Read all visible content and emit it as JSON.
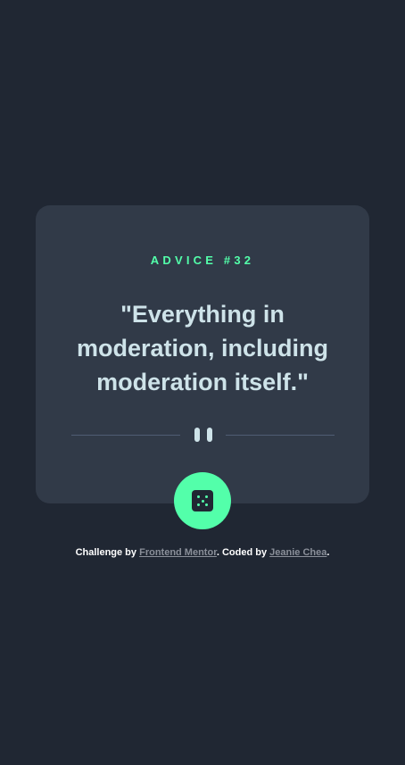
{
  "advice": {
    "label": "ADVICE #32",
    "quote": "\"Everything in moderation, including moderation itself.\""
  },
  "icons": {
    "divider": "pause-icon",
    "dice": "dice-icon"
  },
  "footer": {
    "prefix": "Challenge by ",
    "link1": "Frontend Mentor",
    "middle": ". Coded by ",
    "link2": "Jeanie Chea",
    "suffix": "."
  },
  "colors": {
    "background": "#202733",
    "card": "#313a48",
    "accent": "#53ffaa",
    "text": "#cee3e9",
    "divider": "#4f5d74"
  }
}
